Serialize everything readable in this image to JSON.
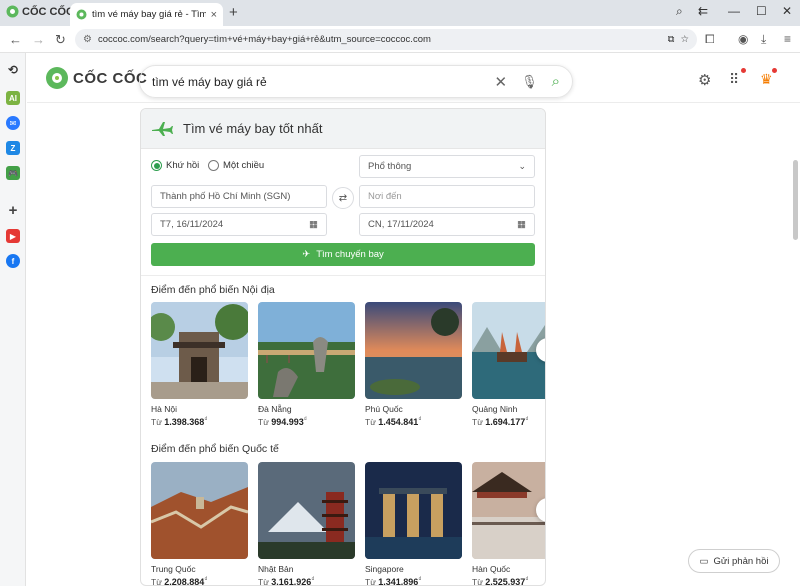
{
  "browser": {
    "brand": "CỐC CỐC",
    "tab_title": "tìm vé máy bay giá rẻ - Tìm",
    "url": "coccoc.com/search?query=tìm+vé+máy+bay+giá+rẻ&utm_source=coccoc.com"
  },
  "header": {
    "logo_text": "CỐC CỐC",
    "search_query": "tìm vé máy bay giá rẻ"
  },
  "flight": {
    "title": "Tìm vé máy bay tốt nhất",
    "trip_round": "Khứ hồi",
    "trip_oneway": "Một chiều",
    "cabin": "Phổ thông",
    "from": "Thành phố Hồ Chí Minh (SGN)",
    "to_placeholder": "Nơi đến",
    "depart_date": "T7, 16/11/2024",
    "return_date": "CN, 17/11/2024",
    "search_button": "Tìm chuyến bay"
  },
  "domestic": {
    "heading": "Điểm đến phổ biến Nội địa",
    "items": [
      {
        "name": "Hà Nội",
        "prefix": "Từ",
        "price": "1.398.368",
        "currency": "₫"
      },
      {
        "name": "Đà Nẵng",
        "prefix": "Từ",
        "price": "994.993",
        "currency": "₫"
      },
      {
        "name": "Phú Quốc",
        "prefix": "Từ",
        "price": "1.454.841",
        "currency": "₫"
      },
      {
        "name": "Quảng Ninh",
        "prefix": "Từ",
        "price": "1.694.177",
        "currency": "₫"
      }
    ]
  },
  "international": {
    "heading": "Điểm đến phổ biến Quốc tế",
    "items": [
      {
        "name": "Trung Quốc",
        "prefix": "Từ",
        "price": "2.208.884",
        "currency": "₫"
      },
      {
        "name": "Nhật Bản",
        "prefix": "Từ",
        "price": "3.161.926",
        "currency": "₫"
      },
      {
        "name": "Singapore",
        "prefix": "Từ",
        "price": "1.341.896",
        "currency": "₫"
      },
      {
        "name": "Hàn Quốc",
        "prefix": "Từ",
        "price": "2.525.937",
        "currency": "₫"
      }
    ]
  },
  "feedback": {
    "label": "Gửi phản hồi"
  },
  "colors": {
    "accent": "#4caf50",
    "badge": "#e53935"
  }
}
